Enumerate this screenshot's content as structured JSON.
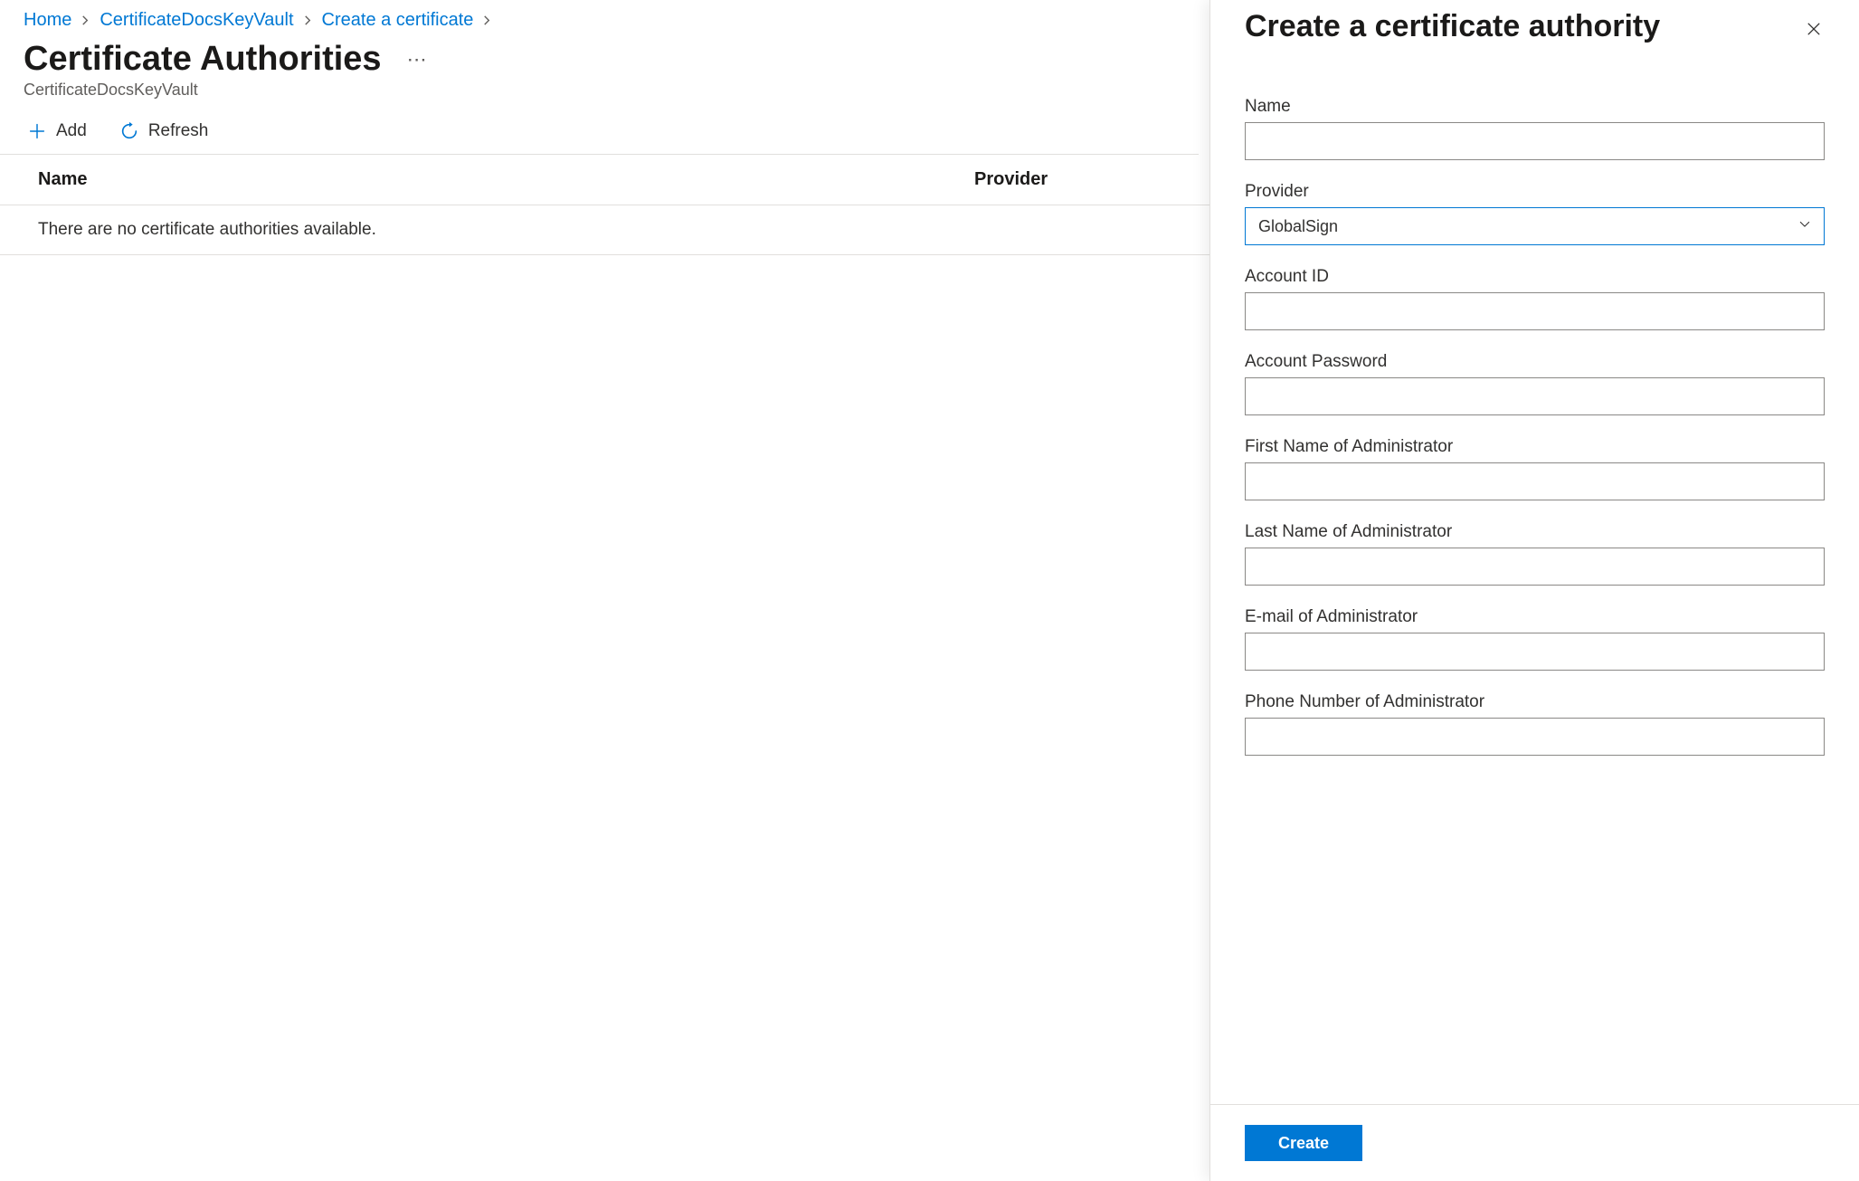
{
  "breadcrumb": {
    "items": [
      {
        "label": "Home"
      },
      {
        "label": "CertificateDocsKeyVault"
      },
      {
        "label": "Create a certificate"
      }
    ]
  },
  "page": {
    "title": "Certificate Authorities",
    "subtitle": "CertificateDocsKeyVault"
  },
  "toolbar": {
    "add_label": "Add",
    "refresh_label": "Refresh"
  },
  "table": {
    "headers": {
      "name": "Name",
      "provider": "Provider"
    },
    "empty_message": "There are no certificate authorities available."
  },
  "panel": {
    "title": "Create a certificate authority",
    "fields": {
      "name_label": "Name",
      "name_value": "",
      "provider_label": "Provider",
      "provider_value": "GlobalSign",
      "account_id_label": "Account ID",
      "account_id_value": "",
      "account_password_label": "Account Password",
      "account_password_value": "",
      "first_name_label": "First Name of Administrator",
      "first_name_value": "",
      "last_name_label": "Last Name of Administrator",
      "last_name_value": "",
      "email_label": "E-mail of Administrator",
      "email_value": "",
      "phone_label": "Phone Number of Administrator",
      "phone_value": ""
    },
    "footer": {
      "create_label": "Create"
    }
  },
  "colors": {
    "link": "#0078d4",
    "primary": "#0078d4",
    "border": "#8a8886"
  }
}
